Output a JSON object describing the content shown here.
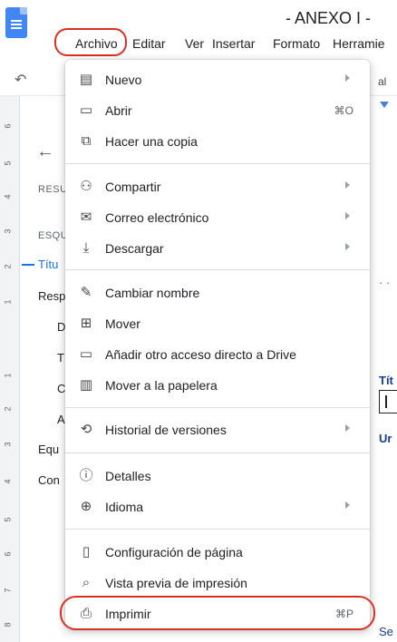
{
  "doc": {
    "title": "- ANEXO I -"
  },
  "menubar": {
    "items": [
      "Archivo",
      "Editar",
      "Ver",
      "Insertar",
      "Formato",
      "Herramie"
    ]
  },
  "toolbar": {
    "font_fragment": "al"
  },
  "ruler": {
    "labels": [
      "6",
      "5",
      "4",
      "3",
      "2",
      "1",
      "1",
      "2",
      "3",
      "4",
      "5",
      "6",
      "7",
      "8"
    ]
  },
  "outline": {
    "resumen": "RESU",
    "esquema": "ESQU",
    "items": [
      "Títu",
      "Resp",
      "D",
      "T",
      "C",
      "A",
      "Equ",
      "Con"
    ]
  },
  "right": {
    "tit": "Tít",
    "ur": "Ur",
    "se": "Se"
  },
  "menu": {
    "items": [
      {
        "icon": "new-document-icon",
        "glyph": "▤",
        "label": "Nuevo",
        "submenu": true
      },
      {
        "icon": "folder-icon",
        "glyph": "▭",
        "label": "Abrir",
        "shortcut": "⌘O"
      },
      {
        "icon": "copy-icon",
        "glyph": "⧉",
        "label": "Hacer una copia"
      },
      {
        "icon": "share-icon",
        "glyph": "⁺",
        "label": "Compartir",
        "submenu": true
      },
      {
        "icon": "email-icon",
        "glyph": "✉",
        "label": "Correo electrónico",
        "submenu": true
      },
      {
        "icon": "download-icon",
        "glyph": "⤓",
        "label": "Descargar",
        "submenu": true
      },
      {
        "icon": "rename-icon",
        "glyph": "✎",
        "label": "Cambiar nombre"
      },
      {
        "icon": "move-icon",
        "glyph": "⊞",
        "label": "Mover"
      },
      {
        "icon": "drive-shortcut-icon",
        "glyph": "▭",
        "label": "Añadir otro acceso directo a Drive"
      },
      {
        "icon": "trash-icon",
        "glyph": "🗑",
        "label": "Mover a la papelera"
      },
      {
        "icon": "history-icon",
        "glyph": "⟲",
        "label": "Historial de versiones",
        "submenu": true
      },
      {
        "icon": "info-icon",
        "glyph": "ⓘ",
        "label": "Detalles"
      },
      {
        "icon": "globe-icon",
        "glyph": "⊕",
        "label": "Idioma",
        "submenu": true
      },
      {
        "icon": "page-setup-icon",
        "glyph": "▯",
        "label": "Configuración de página"
      },
      {
        "icon": "print-preview-icon",
        "glyph": "⌕",
        "label": "Vista previa de impresión"
      },
      {
        "icon": "printer-icon",
        "glyph": "⎙",
        "label": "Imprimir",
        "shortcut": "⌘P"
      }
    ]
  },
  "colors": {
    "accent": "#1a73e8",
    "highlight_ring": "#d93025",
    "docs_blue": "#4285f4"
  }
}
